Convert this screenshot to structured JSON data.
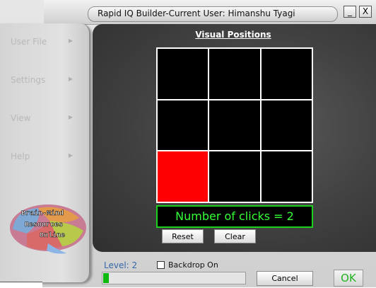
{
  "window": {
    "title": "Rapid IQ Builder-Current User: Himanshu  Tyagi",
    "minimize_label": "_",
    "close_label": "X"
  },
  "sidebar": {
    "items": [
      {
        "label": "User File",
        "arrow": "▶"
      },
      {
        "label": "Settings",
        "arrow": "▶"
      },
      {
        "label": "View",
        "arrow": "▶"
      },
      {
        "label": "Help",
        "arrow": "▶"
      }
    ],
    "logo": {
      "line1": "Brain-Mind",
      "line2": "Resources",
      "line3": "Online"
    }
  },
  "main": {
    "title": "Visual Positions",
    "grid": {
      "rows": 3,
      "cols": 3,
      "active_cells": [
        [
          2,
          0
        ]
      ],
      "active_color": "#ff0000",
      "cell_color": "#000000",
      "line_color": "#ffffff"
    },
    "clicks_text": "Number of clicks = 2",
    "reset_label": "Reset",
    "clear_label": "Clear"
  },
  "bottom": {
    "level_text": "Level: 2",
    "backdrop_label": "Backdrop On",
    "backdrop_checked": false,
    "progress_fraction": 0.04,
    "progress_color": "#0eb80e",
    "cancel_label": "Cancel",
    "ok_label": "OK"
  }
}
